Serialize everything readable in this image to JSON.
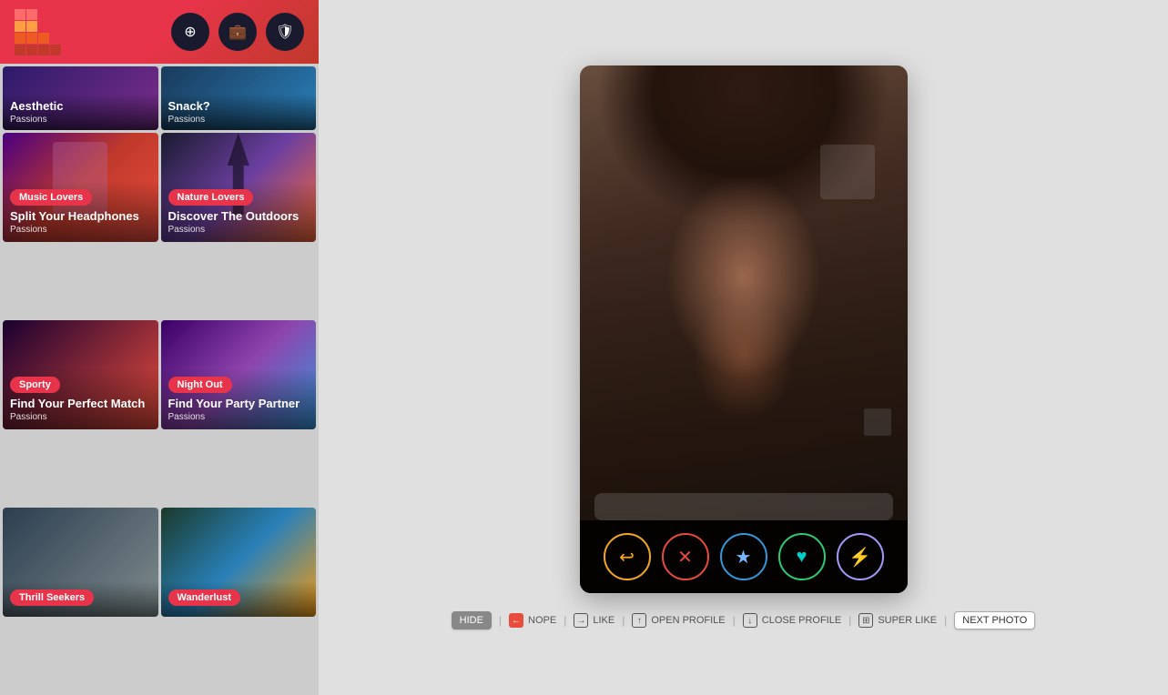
{
  "topBar": {
    "iconSearch": "⊕",
    "iconBriefcase": "💼",
    "iconShield": "🛡"
  },
  "topCards": [
    {
      "id": "aesthetic",
      "badge": "",
      "title": "Aesthetic",
      "subtitle": "Passions",
      "bgClass": "bg-aesthetic"
    },
    {
      "id": "snack",
      "badge": "",
      "title": "Snack?",
      "subtitle": "Passions",
      "bgClass": "bg-snack"
    }
  ],
  "cards": [
    {
      "id": "music",
      "badge": "Music Lovers",
      "title": "Split Your Headphones",
      "subtitle": "Passions",
      "bgClass": "bg-music"
    },
    {
      "id": "nature",
      "badge": "Nature Lovers",
      "title": "Discover The Outdoors",
      "subtitle": "Passions",
      "bgClass": "bg-nature"
    },
    {
      "id": "sporty",
      "badge": "Sporty",
      "title": "Find Your Perfect Match",
      "subtitle": "Passions",
      "bgClass": "bg-sporty"
    },
    {
      "id": "nightout",
      "badge": "Night Out",
      "title": "Find Your Party Partner",
      "subtitle": "Passions",
      "bgClass": "bg-nightout"
    },
    {
      "id": "thrill",
      "badge": "Thrill Seekers",
      "title": "",
      "subtitle": "",
      "bgClass": "bg-thrill"
    },
    {
      "id": "wanderlust",
      "badge": "Wanderlust",
      "title": "",
      "subtitle": "",
      "bgClass": "bg-wanderlust"
    }
  ],
  "actionButtons": [
    {
      "id": "undo",
      "icon": "↩",
      "class": "btn-undo",
      "label": "Undo"
    },
    {
      "id": "nope",
      "icon": "✕",
      "class": "btn-nope",
      "label": "Nope"
    },
    {
      "id": "star",
      "icon": "★",
      "class": "btn-star",
      "label": "Super Like"
    },
    {
      "id": "like",
      "icon": "♥",
      "class": "btn-like",
      "label": "Like"
    },
    {
      "id": "boost",
      "icon": "⚡",
      "class": "btn-boost",
      "label": "Boost"
    }
  ],
  "shortcuts": [
    {
      "id": "hide",
      "key": "HIDE",
      "isHide": true,
      "label": ""
    },
    {
      "id": "nope",
      "icon": "←",
      "iconClass": "icon-nope",
      "text": "NOPE"
    },
    {
      "id": "like",
      "icon": "→",
      "iconClass": "icon-like",
      "text": "LIKE"
    },
    {
      "id": "open-profile",
      "icon": "↑",
      "iconClass": "icon-open",
      "text": "OPEN PROFILE"
    },
    {
      "id": "close-profile",
      "icon": "↓",
      "iconClass": "icon-close",
      "text": "CLOSE PROFILE"
    },
    {
      "id": "super-like",
      "icon": "⊞",
      "iconClass": "icon-super",
      "text": "SUPER LIKE"
    },
    {
      "id": "next-photo",
      "key": "NEXT PHOTO",
      "isKey": true,
      "label": ""
    }
  ]
}
